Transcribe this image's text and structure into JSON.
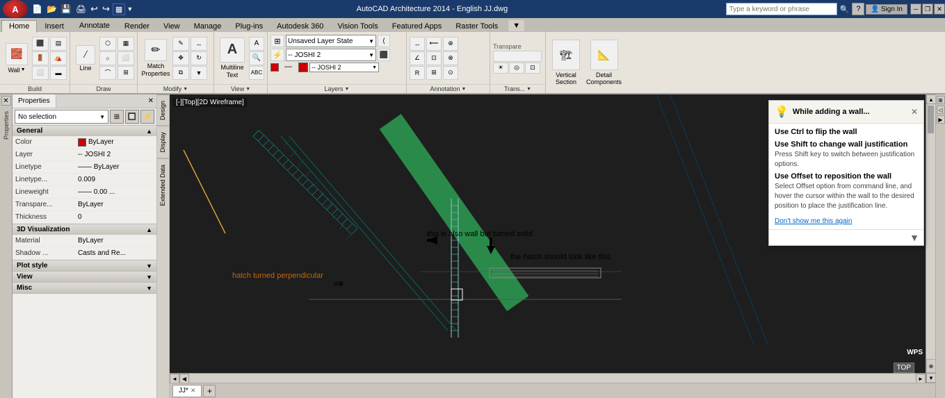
{
  "titlebar": {
    "title": "AutoCAD Architecture 2014 - English  JJ.dwg",
    "controls": [
      "minimize",
      "restore",
      "close"
    ]
  },
  "qat": {
    "buttons": [
      "new",
      "open",
      "save",
      "print",
      "undo",
      "redo",
      "workspace",
      "more"
    ]
  },
  "tabs": {
    "items": [
      "Home",
      "Insert",
      "Annotate",
      "Render",
      "View",
      "Manage",
      "Plug-ins",
      "Autodesk 360",
      "Vision Tools",
      "Featured Apps",
      "Raster Tools"
    ]
  },
  "ribbon": {
    "groups": [
      {
        "label": "Build",
        "tools": [
          "Wall",
          "Column",
          "Roof",
          "Floor",
          "Ceiling",
          "Stair"
        ]
      },
      {
        "label": "Draw"
      },
      {
        "label": "Modify"
      },
      {
        "label": "View"
      },
      {
        "label": "Layers"
      },
      {
        "label": "Annotation"
      }
    ],
    "match_properties": "Match Properties",
    "multiline_text": "Multiline Text"
  },
  "searchbox": {
    "placeholder": "Type a keyword or phrase"
  },
  "signin": {
    "label": "Sign In"
  },
  "viewport": {
    "label": "[-][Top][2D Wireframe]"
  },
  "properties_panel": {
    "title": "Properties",
    "selection": "No selection",
    "sections": {
      "general": {
        "label": "General",
        "rows": [
          {
            "key": "Color",
            "value": "ByLayer",
            "has_swatch": true
          },
          {
            "key": "Layer",
            "value": "-- JOSHI 2"
          },
          {
            "key": "Linetype",
            "value": "——  ByLayer"
          },
          {
            "key": "Linetype...",
            "value": "0.009"
          },
          {
            "key": "Lineweight",
            "value": "—— 0.00 ..."
          },
          {
            "key": "Transpare...",
            "value": "ByLayer"
          },
          {
            "key": "Thickness",
            "value": "0"
          }
        ]
      },
      "visualization3d": {
        "label": "3D Visualization",
        "rows": [
          {
            "key": "Material",
            "value": "ByLayer"
          },
          {
            "key": "Shadow ...",
            "value": "Casts and Re..."
          }
        ]
      },
      "plotstyle": {
        "label": "Plot style"
      },
      "view": {
        "label": "View"
      },
      "misc": {
        "label": "Misc"
      }
    }
  },
  "side_tabs": [
    "Design",
    "Display",
    "Extended Data"
  ],
  "tooltip": {
    "title": "While adding a wall...",
    "sections": [
      {
        "heading": "Use Ctrl to flip the wall"
      },
      {
        "heading": "Use Shift to change wall justification",
        "text": "Press Shift key to switch between justification options."
      },
      {
        "heading": "Use Offset to reposition the wall",
        "text": "Select Offset option from command line, and hover the cursor within the wall to the desired position to place the justification line."
      }
    ],
    "link": "Don't show me this again"
  },
  "annotations": {
    "wall_turned_solid": "this is also wall but turned solid",
    "arrow1": "→",
    "hatch_perpendicular": "hatch turned perpendicular",
    "arrow2": "→",
    "hatch_note": "the hatch should look like this",
    "arrow3": "↓"
  },
  "drawing_tab": {
    "name": "JJ*",
    "plus_label": "+"
  },
  "layers": {
    "state": "Unsaved Layer State",
    "current": "-- JOSHI 2"
  }
}
